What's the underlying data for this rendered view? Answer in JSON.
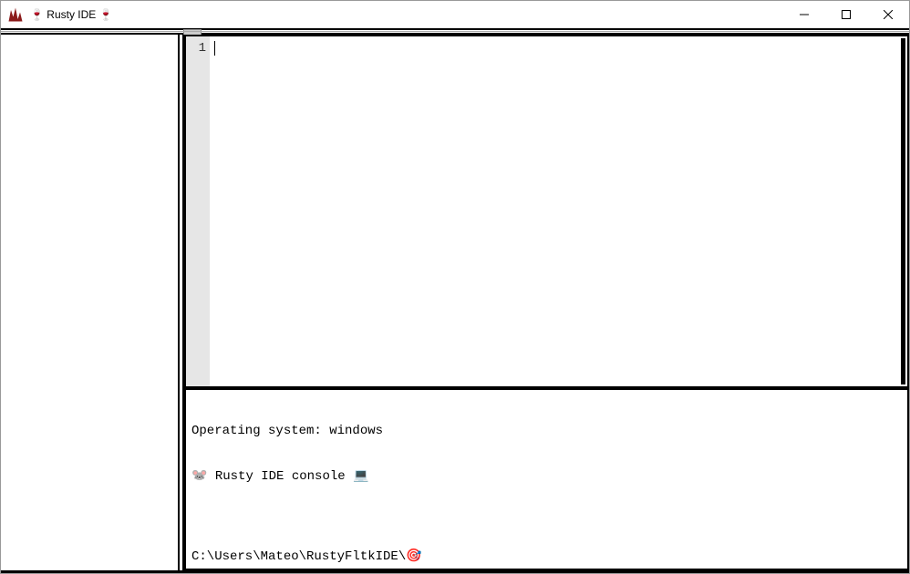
{
  "window": {
    "title": "🍷 Rusty IDE 🍷"
  },
  "editor": {
    "gutter_lines": [
      "1"
    ],
    "content": ""
  },
  "console": {
    "line1": "Operating system: windows",
    "line2_prefix": "🐭",
    "line2_text": " Rusty IDE console ",
    "line2_suffix": "💻",
    "prompt_path": "C:\\Users\\Mateo\\RustyFltkIDE\\",
    "prompt_icon": "🎯"
  }
}
